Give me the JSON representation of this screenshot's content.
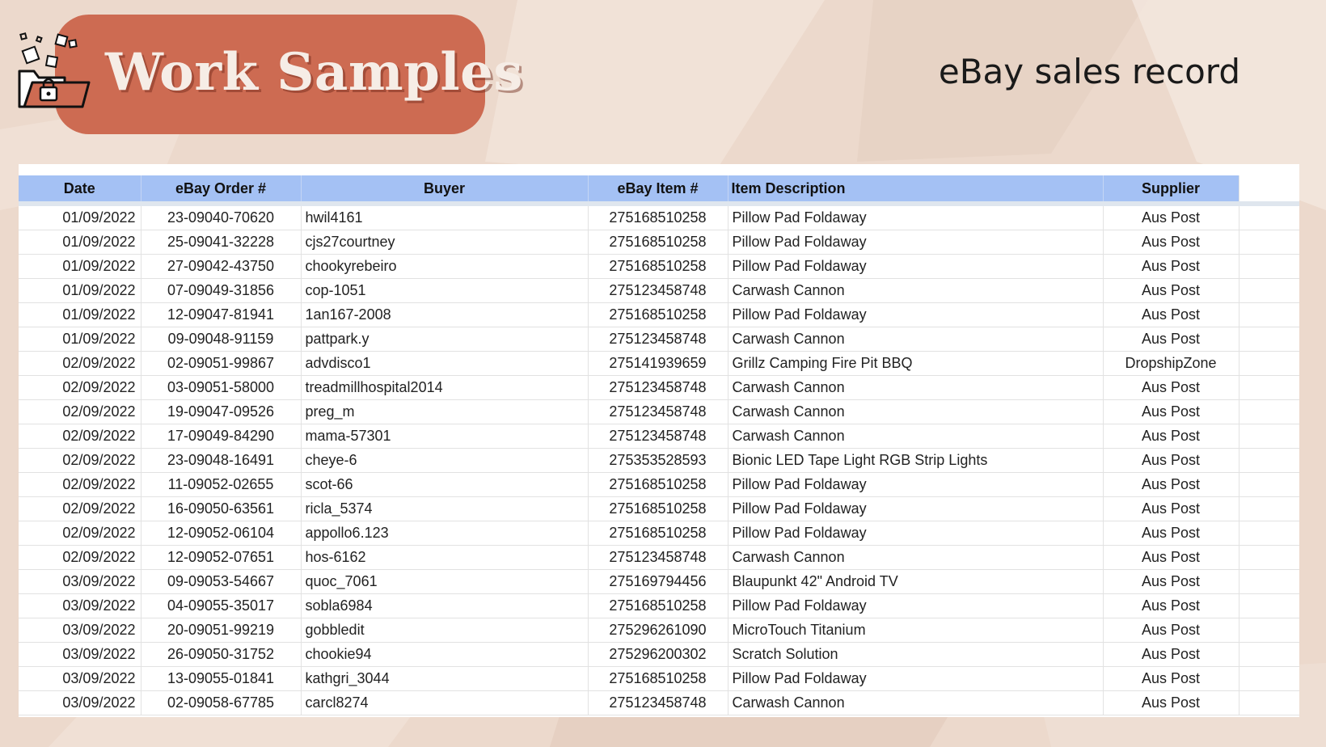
{
  "header": {
    "title": "Work Samples",
    "subtitle": "eBay sales record"
  },
  "table": {
    "columns": [
      "Date",
      "eBay Order #",
      "Buyer",
      "eBay Item #",
      "Item Description",
      "Supplier"
    ],
    "rows": [
      [
        "01/09/2022",
        "23-09040-70620",
        "hwil4161",
        "275168510258",
        "Pillow Pad Foldaway",
        "Aus Post"
      ],
      [
        "01/09/2022",
        "25-09041-32228",
        "cjs27courtney",
        "275168510258",
        "Pillow Pad Foldaway",
        "Aus Post"
      ],
      [
        "01/09/2022",
        "27-09042-43750",
        "chookyrebeiro",
        "275168510258",
        "Pillow Pad Foldaway",
        "Aus Post"
      ],
      [
        "01/09/2022",
        "07-09049-31856",
        "cop-1051",
        "275123458748",
        "Carwash Cannon",
        "Aus Post"
      ],
      [
        "01/09/2022",
        "12-09047-81941",
        "1an167-2008",
        "275168510258",
        "Pillow Pad Foldaway",
        "Aus Post"
      ],
      [
        "01/09/2022",
        "09-09048-91159",
        "pattpark.y",
        "275123458748",
        "Carwash Cannon",
        "Aus Post"
      ],
      [
        "02/09/2022",
        "02-09051-99867",
        "advdisco1",
        "275141939659",
        "Grillz Camping Fire Pit BBQ",
        "DropshipZone"
      ],
      [
        "02/09/2022",
        "03-09051-58000",
        "treadmillhospital2014",
        "275123458748",
        "Carwash Cannon",
        "Aus Post"
      ],
      [
        "02/09/2022",
        "19-09047-09526",
        "preg_m",
        "275123458748",
        "Carwash Cannon",
        "Aus Post"
      ],
      [
        "02/09/2022",
        "17-09049-84290",
        "mama-57301",
        "275123458748",
        "Carwash Cannon",
        "Aus Post"
      ],
      [
        "02/09/2022",
        "23-09048-16491",
        "cheye-6",
        "275353528593",
        "Bionic LED Tape Light RGB Strip Lights",
        "Aus Post"
      ],
      [
        "02/09/2022",
        "11-09052-02655",
        "scot-66",
        "275168510258",
        "Pillow Pad Foldaway",
        "Aus Post"
      ],
      [
        "02/09/2022",
        "16-09050-63561",
        "ricla_5374",
        "275168510258",
        "Pillow Pad Foldaway",
        "Aus Post"
      ],
      [
        "02/09/2022",
        "12-09052-06104",
        "appollo6.123",
        "275168510258",
        "Pillow Pad Foldaway",
        "Aus Post"
      ],
      [
        "02/09/2022",
        "12-09052-07651",
        "hos-6162",
        "275123458748",
        "Carwash Cannon",
        "Aus Post"
      ],
      [
        "03/09/2022",
        "09-09053-54667",
        "quoc_7061",
        "275169794456",
        "Blaupunkt 42\" Android TV",
        "Aus Post"
      ],
      [
        "03/09/2022",
        "04-09055-35017",
        "sobla6984",
        "275168510258",
        "Pillow Pad Foldaway",
        "Aus Post"
      ],
      [
        "03/09/2022",
        "20-09051-99219",
        "gobbledit",
        "275296261090",
        "MicroTouch Titanium",
        "Aus Post"
      ],
      [
        "03/09/2022",
        "26-09050-31752",
        "chookie94",
        "275296200302",
        "Scratch Solution",
        "Aus Post"
      ],
      [
        "03/09/2022",
        "13-09055-01841",
        "kathgri_3044",
        "275168510258",
        "Pillow Pad Foldaway",
        "Aus Post"
      ],
      [
        "03/09/2022",
        "02-09058-67785",
        "carcl8274",
        "275123458748",
        "Carwash Cannon",
        "Aus Post"
      ]
    ]
  },
  "colors": {
    "badge": "#cd6b52",
    "header_row": "#a4c1f4",
    "background": "#ecd9cc"
  },
  "icons": {
    "header_logo": "folder-with-lock-icon"
  }
}
